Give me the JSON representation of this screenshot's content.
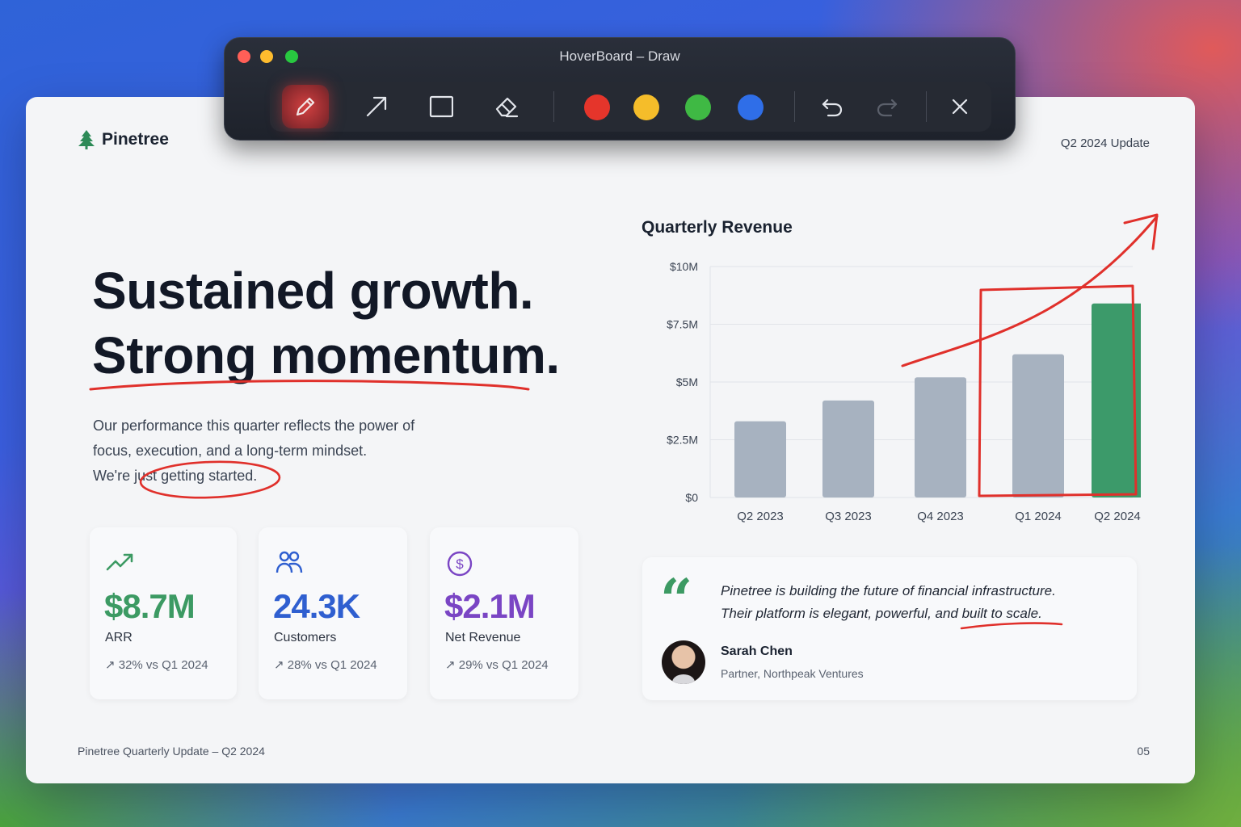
{
  "window": {
    "title": "HoverBoard – Draw"
  },
  "toolbar": {
    "tools": [
      {
        "icon": "pencil-icon",
        "active": true
      },
      {
        "icon": "arrow-icon",
        "active": false
      },
      {
        "icon": "rectangle-icon",
        "active": false
      },
      {
        "icon": "eraser-icon",
        "active": false
      }
    ],
    "colors": [
      "#e5352b",
      "#f5bd2a",
      "#3fb944",
      "#2f6ee8"
    ],
    "actions": [
      "undo-icon",
      "redo-icon",
      "close-icon"
    ]
  },
  "slide": {
    "brand": "Pinetree",
    "header_right": "Q2 2024 Update",
    "headline_line1": "Sustained growth.",
    "headline_line2": "Strong momentum.",
    "body_line1": "Our performance this quarter reflects the power of",
    "body_line2": "focus, execution, and a long-term mindset.",
    "body_line3_a": "We're ",
    "body_line3_b": "just getting started.",
    "metrics": [
      {
        "value": "$8.7M",
        "label": "ARR",
        "delta": "↗ 32% vs Q1 2024",
        "color": "#3c9a63",
        "icon": "trending-up-icon"
      },
      {
        "value": "24.3K",
        "label": "Customers",
        "delta": "↗ 28% vs Q1 2024",
        "color": "#2f5fd0",
        "icon": "users-icon"
      },
      {
        "value": "$2.1M",
        "label": "Net Revenue",
        "delta": "↗ 29% vs Q1 2024",
        "color": "#7a45c4",
        "icon": "dollar-circle-icon"
      }
    ],
    "quote": {
      "line1": "Pinetree is building the future of financial infrastructure.",
      "line2": "Their platform is elegant, powerful, and built to scale.",
      "name": "Sarah Chen",
      "role": "Partner, Northpeak Ventures"
    },
    "footer_left": "Pinetree Quarterly Update – Q2 2024",
    "footer_right": "05"
  },
  "chart_data": {
    "type": "bar",
    "title": "Quarterly Revenue",
    "categories": [
      "Q2 2023",
      "Q3 2023",
      "Q4 2023",
      "Q1 2024",
      "Q2 2024"
    ],
    "values": [
      3.3,
      4.2,
      5.2,
      6.2,
      8.4
    ],
    "colors": [
      "#a7b2c0",
      "#a7b2c0",
      "#a7b2c0",
      "#a7b2c0",
      "#3c9a6a"
    ],
    "yticks": [
      "$0",
      "$2.5M",
      "$5M",
      "$7.5M",
      "$10M"
    ],
    "ylim": [
      0,
      10
    ],
    "grid": true
  }
}
